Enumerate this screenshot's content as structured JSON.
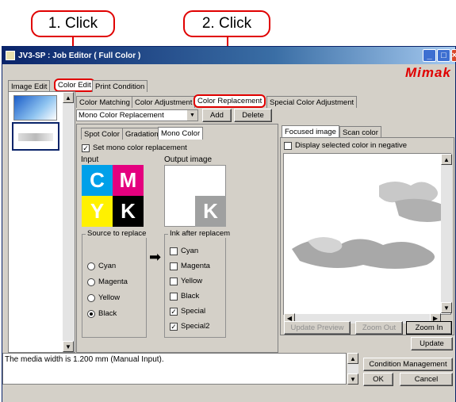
{
  "callouts": {
    "step1": "1. Click",
    "step2": "2. Click"
  },
  "window": {
    "title": "JV3-SP : Job Editor ( Full Color )",
    "brand": "Mimak"
  },
  "main_tabs": [
    "Image Edit",
    "Color Edit",
    "Print Condition"
  ],
  "sub_tabs": [
    "Color Matching",
    "Color Adjustment",
    "Color Replacement",
    "Special Color Adjustment"
  ],
  "replacement": {
    "selected": "Mono Color Replacement",
    "add": "Add",
    "delete": "Delete"
  },
  "inner_tabs": [
    "Spot Color",
    "Gradation",
    "Mono Color"
  ],
  "mono": {
    "set_label": "Set mono color replacement",
    "set_checked": true,
    "input_label": "Input",
    "output_label": "Output image",
    "input_inks": [
      "C",
      "M",
      "Y",
      "K"
    ],
    "output_ink": "K",
    "source_title": "Source to replace",
    "sources": [
      {
        "label": "Cyan",
        "selected": false
      },
      {
        "label": "Magenta",
        "selected": false
      },
      {
        "label": "Yellow",
        "selected": false
      },
      {
        "label": "Black",
        "selected": true
      }
    ],
    "ink_title": "Ink after replacem",
    "inks": [
      {
        "label": "Cyan",
        "checked": false
      },
      {
        "label": "Magenta",
        "checked": false
      },
      {
        "label": "Yellow",
        "checked": false
      },
      {
        "label": "Black",
        "checked": false
      },
      {
        "label": "Special",
        "checked": true
      },
      {
        "label": "Special2",
        "checked": true
      }
    ]
  },
  "preview": {
    "tabs": [
      "Focused image",
      "Scan color"
    ],
    "negative_label": "Display selected color in negative",
    "update_preview": "Update Preview",
    "zoom_out": "Zoom Out",
    "zoom_in": "Zoom In",
    "update": "Update"
  },
  "status": {
    "message": "The media width is 1.200 mm (Manual Input).",
    "condition": "Condition Management",
    "ok": "OK",
    "cancel": "Cancel"
  },
  "colors": {
    "accent": "#e00000",
    "title_bar": "#0a246a",
    "cyan": "#00a0e9",
    "magenta": "#e4007f",
    "yellow": "#fff100",
    "black": "#000000",
    "output_k": "#9fa0a0"
  }
}
